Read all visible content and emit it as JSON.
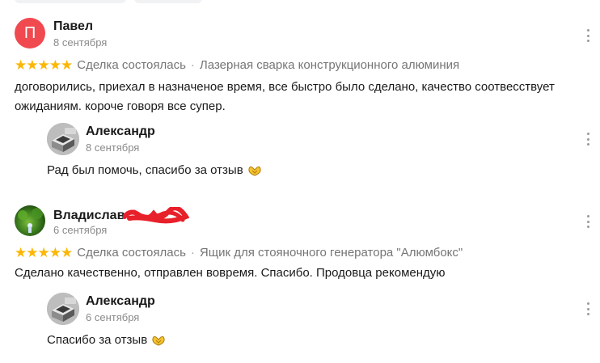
{
  "reviews": [
    {
      "author": "Павел",
      "avatar_letter": "П",
      "date": "8 сентября",
      "rating": 5,
      "deal_status": "Сделка состоялась",
      "item": "Лазерная сварка конструкционного алюминия",
      "text": "договорились, приехал в назначеное время, все быстро было сделано, качество соотвесствует ожиданиям. короче говоря все супер.",
      "reply": {
        "author": "Александр",
        "date": "8 сентября",
        "text": "Рад был помочь, спасибо за отзыв"
      }
    },
    {
      "author": "Владислав",
      "date": "6 сентября",
      "rating": 5,
      "deal_status": "Сделка состоялась",
      "item": "Ящик для стояночного генератора \"Алюмбокс\"",
      "text": "Сделано качественно, отправлен вовремя. Спасибо. Продовца рекомендую",
      "reply": {
        "author": "Александр",
        "date": "6 сентября",
        "text": "Спасибо за отзыв"
      }
    }
  ],
  "icons": {
    "star": "star-icon",
    "more": "more-vertical-icon",
    "emoji": "hands-emoji-icon"
  },
  "colors": {
    "star": "#fcb604",
    "avatar_letter_bg": "#f0494f",
    "redaction": "#e8202a"
  }
}
